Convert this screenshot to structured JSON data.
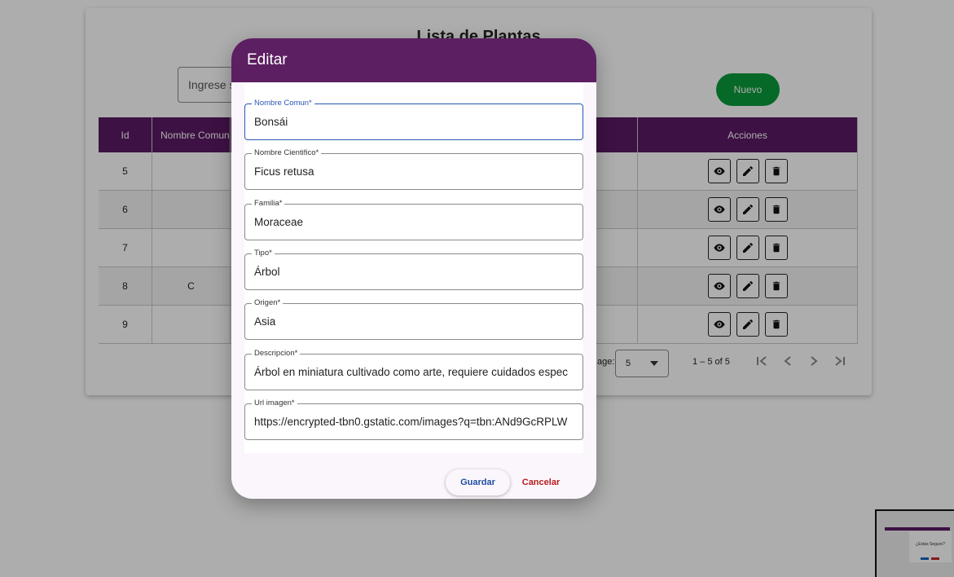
{
  "page": {
    "title": "Lista de Plantas",
    "search_placeholder": "Ingrese s",
    "new_button": "Nuevo"
  },
  "table": {
    "headers": {
      "id": "Id",
      "nombre_comun": "Nombre Comun",
      "acciones": "Acciones"
    },
    "rows": [
      {
        "id": "5",
        "nombre_comun": ""
      },
      {
        "id": "6",
        "nombre_comun": ""
      },
      {
        "id": "7",
        "nombre_comun": ""
      },
      {
        "id": "8",
        "nombre_comun": "C"
      },
      {
        "id": "9",
        "nombre_comun": ""
      }
    ]
  },
  "paginator": {
    "items_per_page_label": "age:",
    "page_size": "5",
    "range": "1 – 5 of 5"
  },
  "thumbnail": {
    "text": "¿Estas Seguro?"
  },
  "dialog": {
    "title": "Editar",
    "fields": [
      {
        "label": "Nombre Comun*",
        "value": "Bonsái"
      },
      {
        "label": "Nombre Cientifico*",
        "value": "Ficus retusa"
      },
      {
        "label": "Familia*",
        "value": "Moraceae"
      },
      {
        "label": "Tipo*",
        "value": "Árbol"
      },
      {
        "label": "Origen*",
        "value": "Asia"
      },
      {
        "label": "Descripcion*",
        "value": "Árbol en miniatura cultivado como arte, requiere cuidados espec"
      },
      {
        "label": "Url imagen*",
        "value": "https://encrypted-tbn0.gstatic.com/images?q=tbn:ANd9GcRPLW"
      }
    ],
    "save_label": "Guardar",
    "cancel_label": "Cancelar"
  },
  "colors": {
    "header_purple": "#5c1f61",
    "nuevo_green": "#0a9b3a",
    "focus_blue": "#2a57b5",
    "cancel_red": "#b71c1c"
  }
}
